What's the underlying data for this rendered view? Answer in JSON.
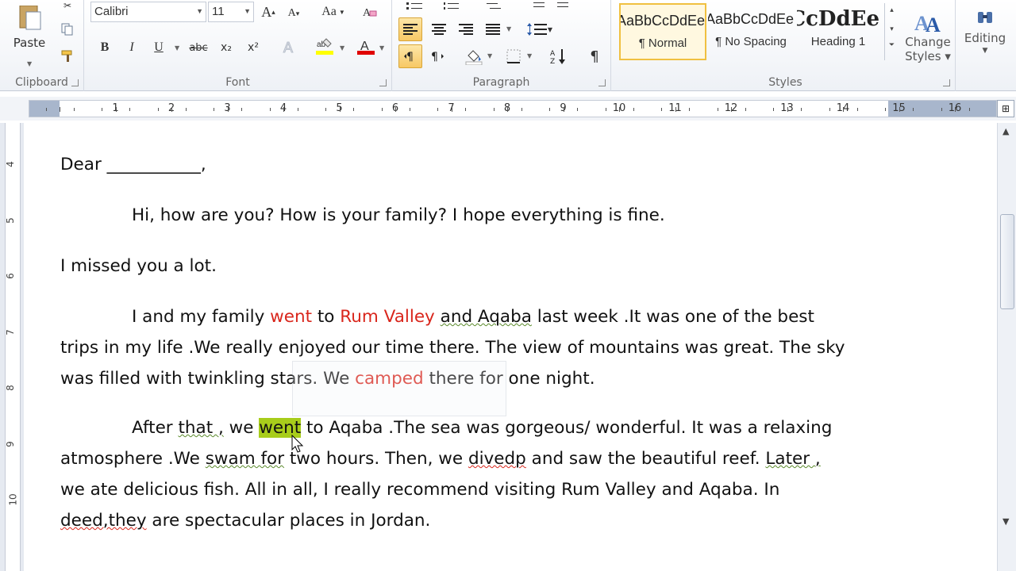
{
  "clipboard": {
    "paste_label": "Paste",
    "group_label": "Clipboard"
  },
  "font": {
    "family": "Calibri",
    "size": "11",
    "group_label": "Font",
    "grow": "A",
    "shrink": "A",
    "change_case": "Aa",
    "bold": "B",
    "italic": "I",
    "underline": "U",
    "strike": "abc",
    "subscript": "x₂",
    "superscript": "x²",
    "font_color_letter": "A",
    "highlight_color": "#ffff00",
    "font_color": "#e00000"
  },
  "paragraph": {
    "group_label": "Paragraph",
    "pilcrow": "¶"
  },
  "styles": {
    "group_label": "Styles",
    "tiles": [
      {
        "preview": "AaBbCcDdEe",
        "name": "¶ Normal"
      },
      {
        "preview": "AaBbCcDdEe",
        "name": "¶ No Spacing"
      },
      {
        "preview": "AaBbCcDdEe",
        "name": "Heading 1"
      }
    ],
    "change_styles_line1": "Change",
    "change_styles_line2": "Styles ▾"
  },
  "editing": {
    "label": "Editing"
  },
  "ruler": {
    "numbers": [
      "1",
      "2",
      "3",
      "4",
      "5",
      "6",
      "7",
      "8",
      "9",
      "10",
      "11",
      "12",
      "13",
      "14",
      "15",
      "16"
    ]
  },
  "vruler": {
    "numbers": [
      "4",
      "5",
      "6",
      "7",
      "8",
      "9",
      "10"
    ]
  },
  "document": {
    "greeting": "Dear ___________,",
    "p1": "Hi, how are you? How is your family? I hope everything is fine.",
    "p2": "I missed you a lot.",
    "p3": {
      "l1_a": "I and my family ",
      "l1_went": "went",
      "l1_b": " to ",
      "l1_rum": "Rum Valley",
      "l1_c": " ",
      "l1_and": "and  Aqaba",
      "l1_d": " last week .It was one of the best",
      "l2": "trips in my life .We really enjoyed our time there. The view of mountains was great. The sky",
      "l3_a": "was filled with twinkling stars. We ",
      "l3_camped": "camped",
      "l3_b": " there for one night."
    },
    "p4": {
      "l1_a": "After ",
      "l1_that": "that ,",
      "l1_b": " we ",
      "l1_went": "went",
      "l1_c": " to Aqaba .The sea was gorgeous/ wonderful. It was a relaxing",
      "l2_a": "atmosphere .We ",
      "l2_swam": "swam  for",
      "l2_b": " two hours. Then, we ",
      "l2_divedp": "divedp",
      "l2_c": " and saw the beautiful reef. ",
      "l2_later": "Later ,",
      "l3": "we ate delicious fish. All in all, I really recommend visiting Rum Valley and Aqaba. In",
      "l4_a": "deed,they",
      "l4_b": " are spectacular places in Jordan."
    }
  }
}
